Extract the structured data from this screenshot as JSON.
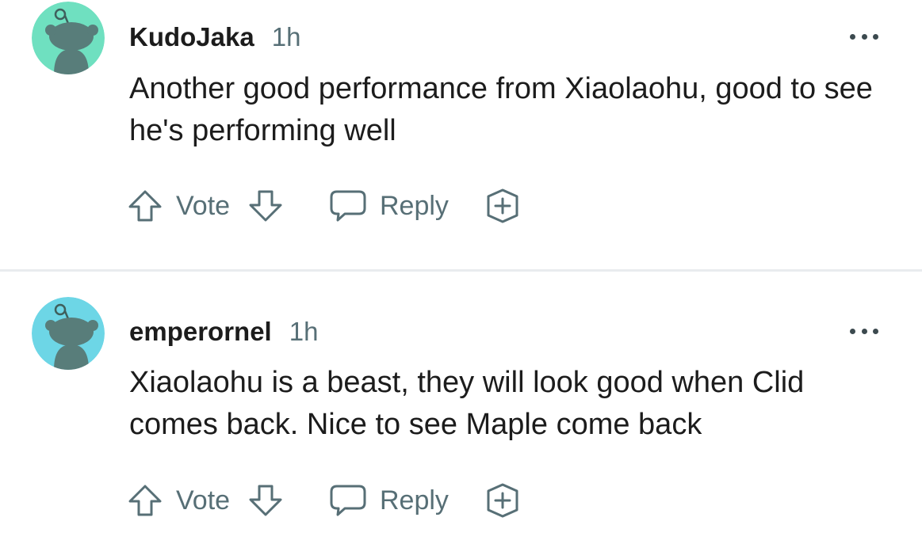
{
  "comments": [
    {
      "username": "KudoJaka",
      "time": "1h",
      "text": "Another good performance from Xiaolaohu, good to see he's performing well",
      "avatar_color": "#6fe0c0",
      "vote_label": "Vote",
      "reply_label": "Reply"
    },
    {
      "username": "emperornel",
      "time": "1h",
      "text": "Xiaolaohu is a beast, they will look good when Clid comes back. Nice to see Maple come back",
      "avatar_color": "#6dd6e6",
      "vote_label": "Vote",
      "reply_label": "Reply"
    }
  ],
  "icons": {
    "avatar": "snoo-avatar-icon",
    "more": "more-options-icon",
    "upvote": "upvote-arrow-icon",
    "downvote": "downvote-arrow-icon",
    "reply": "reply-bubble-icon",
    "award": "award-plus-icon"
  },
  "colors": {
    "meta_gray": "#576f76",
    "snoo_body": "#587d7a",
    "divider": "#e9ecee"
  }
}
